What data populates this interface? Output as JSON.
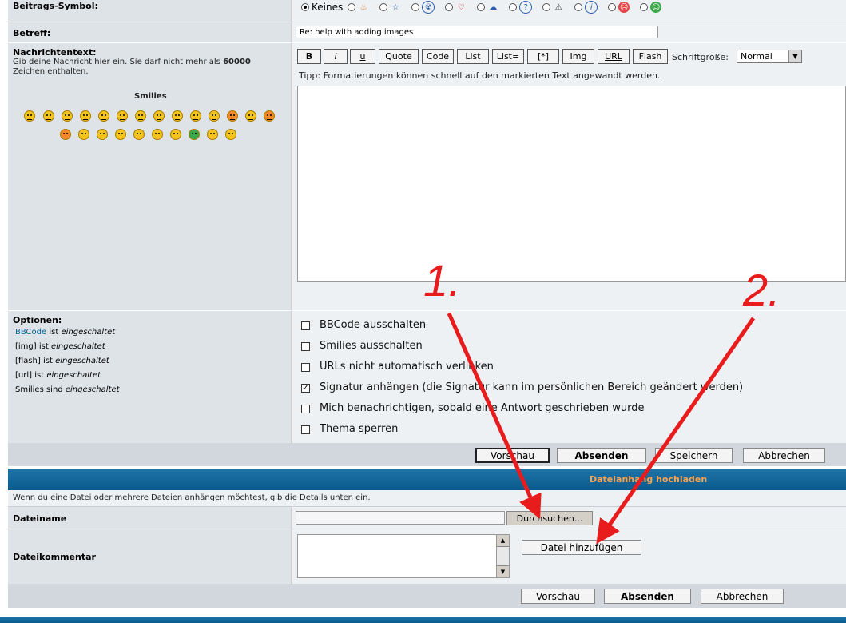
{
  "form": {
    "symbol_label": "Beitrags-Symbol:",
    "symbol_none": "Keines",
    "subject_label": "Betreff:",
    "subject_value": "Re: help with adding images",
    "message_label": "Nachrichtentext:",
    "message_hint_pre": "Gib deine Nachricht hier ein. Sie darf nicht mehr als",
    "message_limit": "60000",
    "message_hint_post": "Zeichen enthalten.",
    "smilies_label": "Smilies",
    "tip": "Tipp: Formatierungen können schnell auf den markierten Text angewandt werden.",
    "fontsize_label": "Schriftgröße:",
    "fontsize_value": "Normal"
  },
  "toolbar": {
    "b": "B",
    "i": "i",
    "u": "u",
    "quote": "Quote",
    "code": "Code",
    "list": "List",
    "list_eq": "List=",
    "star": "[*]",
    "img": "Img",
    "url": "URL",
    "flash": "Flash"
  },
  "options": {
    "label": "Optionen:",
    "bbcode_link": "BBCode",
    "bbcode_rest": "ist",
    "enabled": "eingeschaltet",
    "img": "[img] ist",
    "flash": "[flash] ist",
    "url": "[url] ist",
    "smilies": "Smilies sind",
    "check_bbcode": "BBCode ausschalten",
    "check_smilies": "Smilies ausschalten",
    "check_urls": "URLs nicht automatisch verlinken",
    "check_signature": "Signatur anhängen (die Signatur kann im persönlichen Bereich geändert werden)",
    "check_notify": "Mich benachrichtigen, sobald eine Antwort geschrieben wurde",
    "check_lock": "Thema sperren"
  },
  "actions": {
    "preview": "Vorschau",
    "submit": "Absenden",
    "save": "Speichern",
    "cancel": "Abbrechen"
  },
  "attachment": {
    "title": "Dateianhang hochladen",
    "hint": "Wenn du eine Datei oder mehrere Dateien anhängen möchtest, gib die Details unten ein.",
    "filename_label": "Dateiname",
    "browse": "Durchsuchen...",
    "comment_label": "Dateikommentar",
    "add_file": "Datei hinzufügen"
  },
  "annotations": {
    "one": "1.",
    "two": "2.",
    "color": "#e81c1c"
  }
}
